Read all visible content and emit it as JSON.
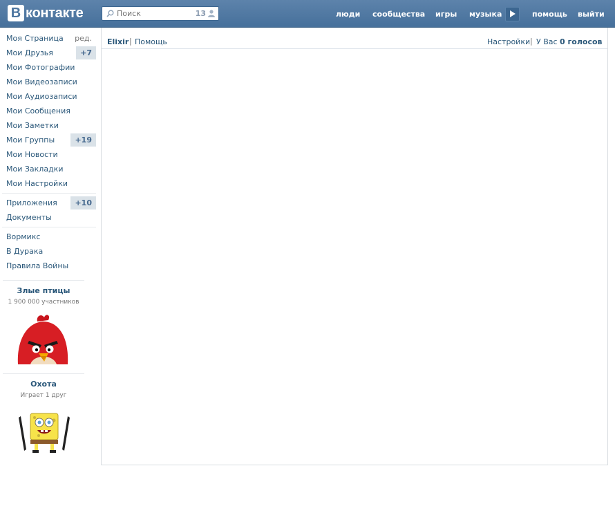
{
  "header": {
    "logo_letter": "В",
    "logo_text": "контакте",
    "search": {
      "placeholder": "Поиск",
      "count": "13"
    },
    "nav": {
      "people": "люди",
      "communities": "сообщества",
      "games": "игры",
      "music": "музыка",
      "help": "помощь",
      "logout": "выйти"
    }
  },
  "sidebar": {
    "items": [
      {
        "label": "Моя Страница",
        "extra": "ред."
      },
      {
        "label": "Мои Друзья",
        "badge": "+7"
      },
      {
        "label": "Мои Фотографии"
      },
      {
        "label": "Мои Видеозаписи"
      },
      {
        "label": "Мои Аудиозаписи"
      },
      {
        "label": "Мои Сообщения"
      },
      {
        "label": "Мои Заметки"
      },
      {
        "label": "Мои Группы",
        "badge": "+19"
      },
      {
        "label": "Мои Новости"
      },
      {
        "label": "Мои Закладки"
      },
      {
        "label": "Мои Настройки"
      },
      {
        "label": "Приложения",
        "badge": "+10"
      },
      {
        "label": "Документы"
      },
      {
        "label": "Вормикс"
      },
      {
        "label": "В Дурака"
      },
      {
        "label": "Правила Войны"
      }
    ],
    "promos": [
      {
        "title": "Злые птицы",
        "subtitle": "1 900 000 участников"
      },
      {
        "title": "Охота",
        "subtitle": "Играет 1 друг"
      }
    ]
  },
  "main": {
    "app_title": "Elixir",
    "separator": "|",
    "help": "Помощь",
    "settings": "Настройки",
    "votes_prefix": "У Вас",
    "votes_value": "0 голосов"
  },
  "colors": {
    "header": "#4d76a0",
    "link": "#2b587a",
    "badge_bg": "#dae2e8"
  }
}
